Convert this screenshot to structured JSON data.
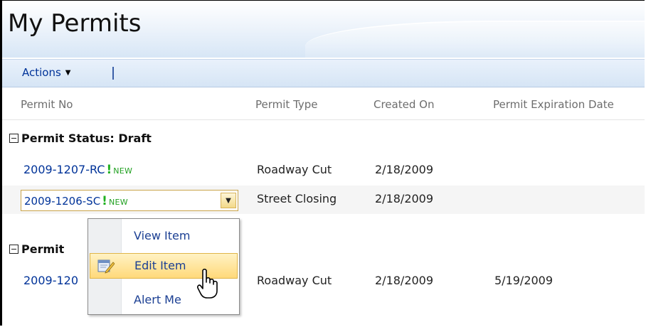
{
  "page": {
    "title": "My Permits"
  },
  "toolbar": {
    "actions_label": "Actions",
    "actions_caret": "▼"
  },
  "columns": [
    "Permit No",
    "Permit Type",
    "Created On",
    "Permit Expiration Date"
  ],
  "groups": [
    {
      "label": "Permit Status: Draft"
    },
    {
      "label": "Permit"
    }
  ],
  "rows": [
    {
      "permit_no": "2009-1207-RC",
      "new_mark": "!",
      "new_label": "NEW",
      "type": "Roadway Cut",
      "created": "2/18/2009",
      "expires": ""
    },
    {
      "permit_no": "2009-1206-SC",
      "new_mark": "!",
      "new_label": "NEW",
      "type": "Street Closing",
      "created": "2/18/2009",
      "expires": ""
    },
    {
      "permit_no": "2009-120",
      "type": "Roadway Cut",
      "created": "2/18/2009",
      "expires": "5/19/2009"
    }
  ],
  "context_menu": {
    "items": [
      {
        "label": "View Item",
        "icon": "none"
      },
      {
        "label": "Edit Item",
        "icon": "edit-item-icon"
      },
      {
        "label": "Alert Me",
        "icon": "none"
      }
    ]
  },
  "colors": {
    "link": "#003399",
    "new_badge": "#20a020",
    "menu_hover": "#ffd97a"
  }
}
